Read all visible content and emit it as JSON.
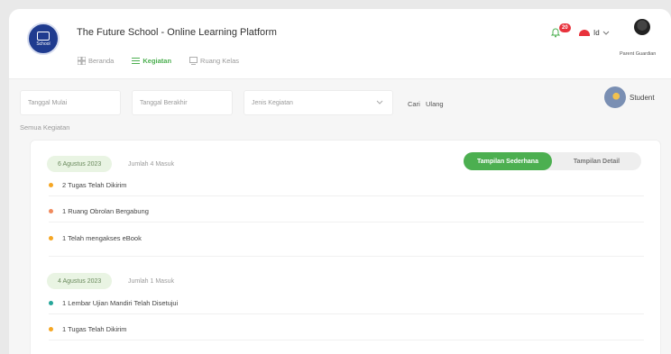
{
  "app": {
    "title": "The Future School - Online Learning Platform",
    "logo_text": "School",
    "notification_count": "20",
    "language": "Id",
    "user_label": "Parent Guardian"
  },
  "nav": {
    "items": [
      {
        "label": "Beranda",
        "icon": "grid-icon",
        "active": false
      },
      {
        "label": "Kegiatan",
        "icon": "list-icon",
        "active": true
      },
      {
        "label": "Ruang Kelas",
        "icon": "classroom-icon",
        "active": false
      }
    ]
  },
  "filters": {
    "start_date_placeholder": "Tanggal Mulai",
    "end_date_placeholder": "Tanggal Berakhir",
    "activity_type_placeholder": "Jenis Kegiatan",
    "search_label": "Cari",
    "reset_label": "Ulang",
    "student_label": "Student"
  },
  "section": {
    "label": "Semua Kegiatan"
  },
  "view_toggle": {
    "simple_label": "Tampilan Sederhana",
    "detail_label": "Tampilan Detail",
    "active": "simple"
  },
  "groups": [
    {
      "date": "6 Agustus 2023",
      "count_text": "Jumlah 4 Masuk",
      "activities": [
        {
          "text": "2 Tugas Telah Dikirim",
          "color": "#f5a623"
        },
        {
          "text": "1 Ruang Obrolan Bergabung",
          "color": "#f08a5d"
        },
        {
          "text": "1 Telah mengakses eBook",
          "color": "#f5a623"
        }
      ]
    },
    {
      "date": "4 Agustus 2023",
      "count_text": "Jumlah 1 Masuk",
      "activities": [
        {
          "text": "1 Lembar Ujian Mandiri Telah Disetujui",
          "color": "#26a69a"
        },
        {
          "text": "1 Tugas Telah Dikirim",
          "color": "#f5a623"
        }
      ]
    }
  ],
  "colors": {
    "accent": "#4caf50",
    "badge": "#e8323c",
    "logo": "#1f3b8f"
  }
}
